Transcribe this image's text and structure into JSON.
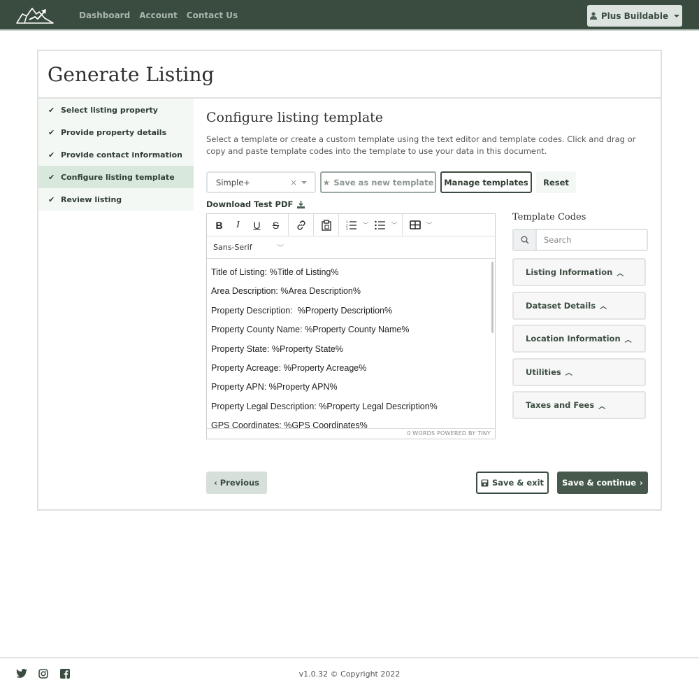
{
  "topnav": {
    "links": [
      "Dashboard",
      "Account",
      "Contact Us"
    ],
    "user_button": "Plus Buildable"
  },
  "page": {
    "title": "Generate Listing"
  },
  "steps": [
    {
      "label": "Select listing property",
      "done": true
    },
    {
      "label": "Provide property details",
      "done": true
    },
    {
      "label": "Provide contact information",
      "done": true
    },
    {
      "label": "Configure listing template",
      "done": true,
      "active": true
    },
    {
      "label": "Review listing",
      "done": true
    }
  ],
  "main": {
    "title": "Configure listing template",
    "description": "Select a template or create a custom template using the text editor and template codes. Click and drag or copy and paste template codes into the template to use your data in this document.",
    "template_select": {
      "value": "Simple+"
    },
    "buttons": {
      "save_new": "Save as new template",
      "manage": "Manage templates",
      "reset": "Reset"
    },
    "download_label": "Download Test PDF"
  },
  "editor": {
    "font_family": "Sans-Serif",
    "lines": [
      "Title of Listing: %Title of Listing%",
      "Area Description: %Area Description%",
      "Property Description:  %Property Description%",
      "Property County Name: %Property County Name%",
      "Property State: %Property State%",
      "Property Acreage: %Property Acreage%",
      "Property APN: %Property APN%",
      "Property Legal Description: %Property Legal Description%",
      "GPS Coordinates: %GPS Coordinates%"
    ],
    "status": "0 WORDS  POWERED BY TINY"
  },
  "codes": {
    "title": "Template Codes",
    "search_placeholder": "Search",
    "sections": [
      "Listing Information",
      "Dataset Details",
      "Location Information",
      "Utilities",
      "Taxes and Fees"
    ]
  },
  "nav_buttons": {
    "previous": "Previous",
    "save_exit": "Save & exit",
    "save_continue": "Save & continue"
  },
  "footer": {
    "copyright": "v1.0.32 © Copyright 2022"
  },
  "colors": {
    "brand": "#3a4c40",
    "active_step": "#d9e8dc",
    "steps_bg": "#f4f8f5"
  }
}
